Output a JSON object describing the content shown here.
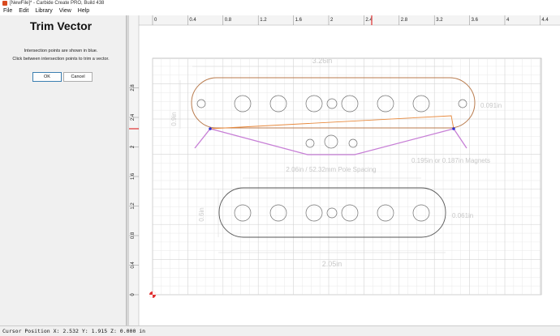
{
  "window": {
    "title": "[NewFile]* - Carbide Create PRO, Build 438"
  },
  "menu": {
    "items": [
      {
        "label": "File",
        "name": "menu-file"
      },
      {
        "label": "Edit",
        "name": "menu-edit"
      },
      {
        "label": "Library",
        "name": "menu-library"
      },
      {
        "label": "View",
        "name": "menu-view"
      },
      {
        "label": "Help",
        "name": "menu-help"
      }
    ]
  },
  "panel": {
    "title": "Trim Vector",
    "line1": "Intersection points are shown in blue.",
    "line2": "Click between intersection points to trim a vector.",
    "ok_label": "OK",
    "cancel_label": "Cancel"
  },
  "rulers": {
    "x_ticks": [
      "0",
      "0.4",
      "0.8",
      "1.2",
      "1.6",
      "2",
      "2.4",
      "2.8",
      "3.2",
      "3.6",
      "4",
      "4.4"
    ],
    "y_ticks": [
      "2.8",
      "2.4",
      "2",
      "1.6",
      "1.2",
      "0.8",
      "0.4",
      "0"
    ]
  },
  "dimensions": {
    "top_width": "3.26in",
    "top_height": "0.9in",
    "top_depth": "0.091in",
    "magnets": "0.195in or 0.187in Magnets",
    "spacing": "2.06in / 52.32mm Pole Spacing",
    "bottom_height": "0.6in",
    "bottom_depth": "0.061in",
    "bottom_width": "2.05in"
  },
  "status": {
    "text": "Cursor Position X: 2.532 Y: 1.915 Z: 0.000 in"
  },
  "colors": {
    "orange_path": "#e8893c",
    "top_outline": "#b87a4c",
    "purple_path": "#c77fd6",
    "bottom_outline": "#555555",
    "cursor_marker": "#e03030"
  }
}
